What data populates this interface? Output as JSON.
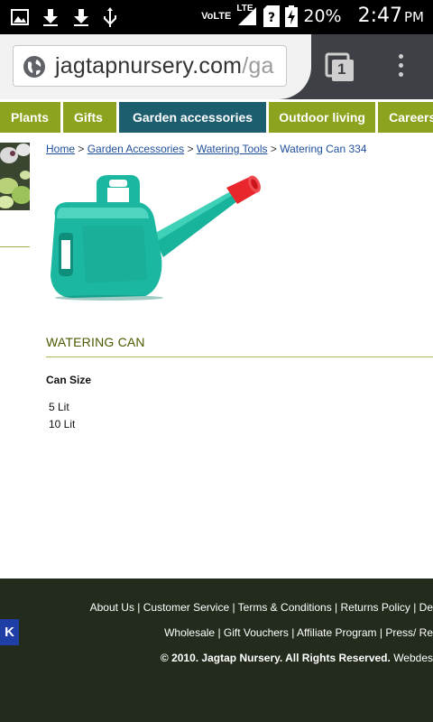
{
  "status_bar": {
    "network": "VoLTE",
    "lte": "LTE",
    "battery": "20%",
    "time": "2:47",
    "ampm": "PM",
    "icons": [
      "gallery-icon",
      "download-icon",
      "download-icon",
      "usb-icon",
      "signal-icon",
      "sim-unknown-icon",
      "battery-charging-icon"
    ]
  },
  "browser": {
    "url_main": "jagtapnursery.com",
    "url_rest": "/ga",
    "tab_count": "1"
  },
  "nav": {
    "items": [
      "Plants",
      "Gifts",
      "Garden accessories",
      "Outdoor living",
      "Careers"
    ],
    "active": "Garden accessories"
  },
  "breadcrumb": {
    "home": "Home",
    "sep": ">",
    "garden": "Garden Accessories",
    "tools": "Watering Tools",
    "current": "Watering Can 334"
  },
  "product": {
    "title": "WATERING CAN",
    "size_label": "Can Size",
    "options": [
      "5 Lit",
      "10 Lit"
    ],
    "colors": {
      "body": "#1bb7a0",
      "spout_tip": "#e8262c"
    }
  },
  "footer": {
    "links_row1": "About Us | Customer Service | Terms & Conditions | Returns Policy | De",
    "links_row2": "Wholesale | Gift Vouchers | Affiliate Program | Press/ Re",
    "copyright": "© 2010. Jagtap Nursery. All Rights Reserved.",
    "webdesign": "Webdes",
    "badge": "K"
  }
}
